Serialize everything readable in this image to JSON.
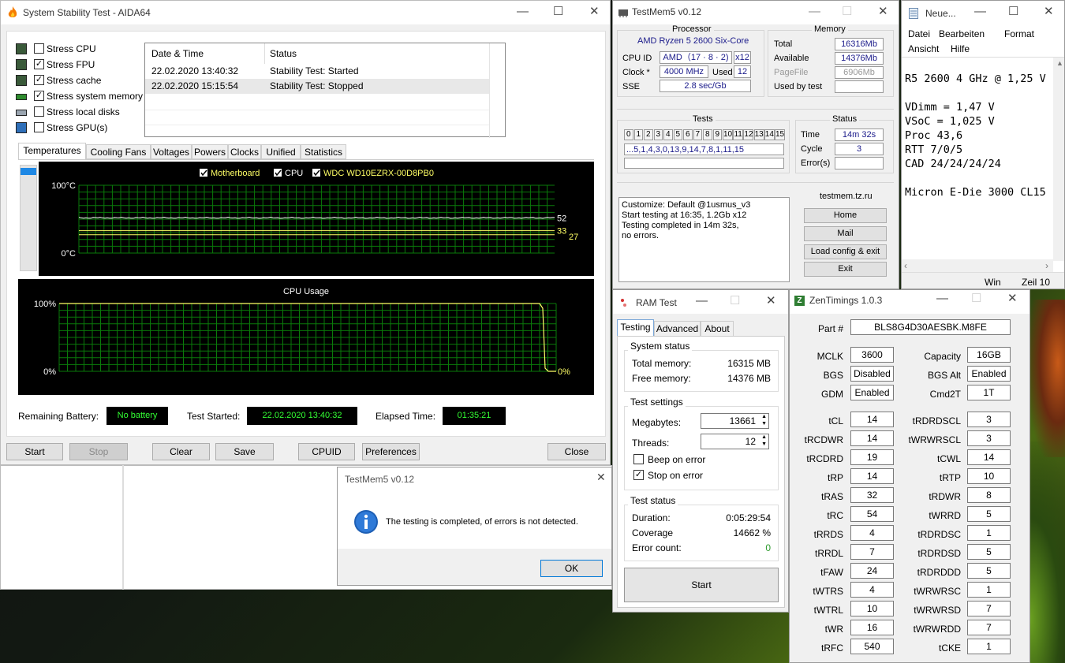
{
  "desktop": {
    "bg": "#101410"
  },
  "aida": {
    "title": "System Stability Test - AIDA64",
    "stress": [
      {
        "label": "Stress CPU",
        "checked": false,
        "icon": "cpu-chip-icon"
      },
      {
        "label": "Stress FPU",
        "checked": true,
        "icon": "fpu-icon"
      },
      {
        "label": "Stress cache",
        "checked": true,
        "icon": "cache-icon"
      },
      {
        "label": "Stress system memory",
        "checked": true,
        "icon": "memory-module-icon"
      },
      {
        "label": "Stress local disks",
        "checked": false,
        "icon": "disk-icon"
      },
      {
        "label": "Stress GPU(s)",
        "checked": false,
        "icon": "monitor-icon"
      }
    ],
    "log": {
      "headers": [
        "Date & Time",
        "Status"
      ],
      "rows": [
        [
          "22.02.2020 13:40:32",
          "Stability Test: Started"
        ],
        [
          "22.02.2020 15:15:54",
          "Stability Test: Stopped"
        ]
      ]
    },
    "tabs": [
      "Temperatures",
      "Cooling Fans",
      "Voltages",
      "Powers",
      "Clocks",
      "Unified",
      "Statistics"
    ],
    "temp_chart": {
      "legend": [
        "Motherboard",
        "CPU",
        "WDC WD10EZRX-00D8PB0"
      ],
      "legend_colors": [
        "#ffff66",
        "#ffffff",
        "#ffff66"
      ],
      "y_top": "100°C",
      "y_bottom": "0°C",
      "values": {
        "CPU": 52,
        "Motherboard": 33,
        "WDC WD10EZRX-00D8PB0": 27
      },
      "labels": [
        "52",
        "33",
        "27"
      ],
      "ymin": 0,
      "ymax": 100
    },
    "cpu_chart": {
      "title": "CPU Usage",
      "y_top": "100%",
      "y_bottom": "0%",
      "current": "0%",
      "value_before": 100,
      "value_after": 0,
      "ymin": 0,
      "ymax": 100
    },
    "status": {
      "battery_label": "Remaining Battery:",
      "battery": "No battery",
      "started_label": "Test Started:",
      "started": "22.02.2020 13:40:32",
      "elapsed_label": "Elapsed Time:",
      "elapsed": "01:35:21"
    },
    "buttons": {
      "start": "Start",
      "stop": "Stop",
      "clear": "Clear",
      "save": "Save",
      "cpuid": "CPUID",
      "preferences": "Preferences",
      "close": "Close"
    }
  },
  "tm5": {
    "title": "TestMem5 v0.12",
    "processor": {
      "group": "Processor",
      "name": "AMD Ryzen 5 2600 Six-Core",
      "cpuid_label": "CPU ID",
      "cpuid": "AMD（17 · 8 · 2)",
      "threads": "x12",
      "clock_label": "Clock *",
      "clock": "4000 MHz",
      "used_label": "Used",
      "used": "12",
      "sse_label": "SSE",
      "sse": "2.8 sec/Gb"
    },
    "memory": {
      "group": "Memory",
      "total_label": "Total",
      "total": "16316Mb",
      "avail_label": "Available",
      "avail": "14376Mb",
      "pagefile_label": "PageFile",
      "pagefile": "6906Mb",
      "usedby_label": "Used by test",
      "usedby": ""
    },
    "tests": {
      "group": "Tests",
      "numbers": [
        "0",
        "1",
        "2",
        "3",
        "4",
        "5",
        "6",
        "7",
        "8",
        "9",
        "10",
        "11",
        "12",
        "13",
        "14",
        "15"
      ],
      "sequence": "...5,1,4,3,0,13,9,14,7,8,1,11,15"
    },
    "status": {
      "group": "Status",
      "time_label": "Time",
      "time": "14m 32s",
      "cycle_label": "Cycle",
      "cycle": "3",
      "errors_label": "Error(s)",
      "errors": ""
    },
    "log": [
      "Customize: Default @1usmus_v3",
      "Start testing at 16:35, 1.2Gb x12",
      "Testing completed in 14m 32s,",
      "no errors."
    ],
    "site": {
      "group": "testmem.tz.ru",
      "home": "Home",
      "mail": "Mail",
      "load": "Load config & exit",
      "exit": "Exit"
    }
  },
  "notepad": {
    "title": "Neue...",
    "menu1": [
      "Datei",
      "Bearbeiten",
      "Format"
    ],
    "menu2": [
      "Ansicht",
      "Hilfe"
    ],
    "lines": [
      "R5 2600 4 GHz @ 1,25 V",
      "",
      "VDimm = 1,47 V",
      "VSoC = 1,025 V",
      "Proc 43,6",
      "RTT 7/0/5",
      "CAD 24/24/24/24",
      "",
      "Micron E-Die 3000 CL15"
    ],
    "status1": "Win",
    "status2": "Zeil 10"
  },
  "ramtest": {
    "title": "RAM Test",
    "tabs": [
      "Testing",
      "Advanced",
      "About"
    ],
    "sys": {
      "group": "System status",
      "total_label": "Total memory:",
      "total": "16315 MB",
      "free_label": "Free memory:",
      "free": "14376 MB"
    },
    "settings": {
      "group": "Test settings",
      "mb_label": "Megabytes:",
      "mb": "13661",
      "threads_label": "Threads:",
      "threads": "12",
      "beep_label": "Beep on error",
      "beep": false,
      "stop_label": "Stop on error",
      "stop": true
    },
    "status": {
      "group": "Test status",
      "duration_label": "Duration:",
      "duration": "0:05:29:54",
      "coverage_label": "Coverage",
      "coverage": "14662 %",
      "errors_label": "Error count:",
      "errors": "0"
    },
    "start": "Start"
  },
  "dialog": {
    "title": "TestMem5 v0.12",
    "message": "The testing is completed, of errors is not detected.",
    "ok": "OK"
  },
  "zen": {
    "title": "ZenTimings 1.0.3",
    "part_label": "Part #",
    "part": "BLS8G4D30AESBK.M8FE",
    "rows_top": [
      [
        "MCLK",
        "3600",
        "Capacity",
        "16GB"
      ],
      [
        "BGS",
        "Disabled",
        "BGS Alt",
        "Enabled"
      ],
      [
        "GDM",
        "Enabled",
        "Cmd2T",
        "1T"
      ]
    ],
    "rows": [
      [
        "tCL",
        "14",
        "tRDRDSCL",
        "3"
      ],
      [
        "tRCDWR",
        "14",
        "tWRWRSCL",
        "3"
      ],
      [
        "tRCDRD",
        "19",
        "tCWL",
        "14"
      ],
      [
        "tRP",
        "14",
        "tRTP",
        "10"
      ],
      [
        "tRAS",
        "32",
        "tRDWR",
        "8"
      ],
      [
        "tRC",
        "54",
        "tWRRD",
        "5"
      ],
      [
        "tRRDS",
        "4",
        "tRDRDSC",
        "1"
      ],
      [
        "tRRDL",
        "7",
        "tRDRDSD",
        "5"
      ],
      [
        "tFAW",
        "24",
        "tRDRDDD",
        "5"
      ],
      [
        "tWTRS",
        "4",
        "tWRWRSC",
        "1"
      ],
      [
        "tWTRL",
        "10",
        "tWRWRSD",
        "7"
      ],
      [
        "tWR",
        "16",
        "tWRWRDD",
        "7"
      ],
      [
        "tRFC",
        "540",
        "tCKE",
        "1"
      ]
    ]
  }
}
